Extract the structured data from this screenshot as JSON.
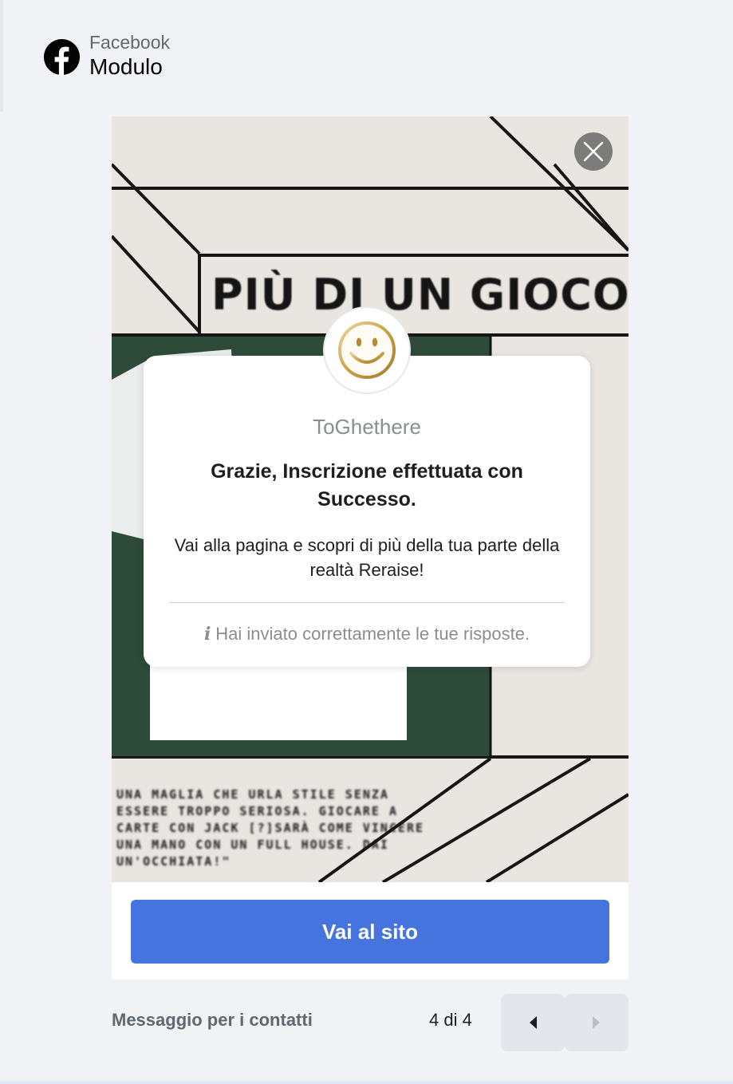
{
  "header": {
    "platform": "Facebook",
    "title": "Modulo"
  },
  "ad_image": {
    "heading": "PIÙ DI UN GIOCO",
    "body_text": "UNA MAGLIA CHE URLA STILE SENZA ESSERE TROPPO SERIOSA. GIOCARE A CARTE CON JACK [?]SARÀ COME VINCERE UNA MANO CON UN FULL HOUSE. DAI UN'OCCHIATA!\""
  },
  "card": {
    "page_name": "ToGhethere",
    "headline": "Grazie, Inscrizione effettuata con Successo.",
    "description": "Vai alla pagina e scopri di più della tua parte della realtà Reraise!",
    "info_text": "Hai inviato correttamente le tue risposte."
  },
  "cta": {
    "label": "Vai al sito"
  },
  "footer": {
    "label": "Messaggio per i contatti",
    "page_indicator": "4 di 4"
  },
  "icons": {
    "logo": "facebook-logo-icon",
    "close": "close-icon",
    "avatar": "smiley-face-icon",
    "info": "info-icon",
    "prev": "caret-left-icon",
    "next": "caret-right-icon"
  },
  "colors": {
    "primary_button": "#4674de",
    "background": "#f0f2f5",
    "muted_text": "#8a8d91",
    "image_green": "#2e4b3a"
  }
}
